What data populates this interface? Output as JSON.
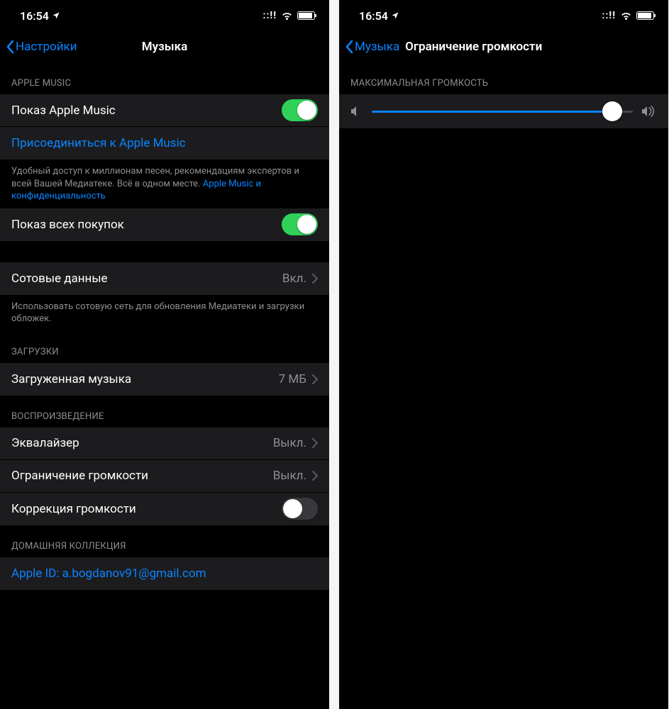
{
  "status": {
    "time": "16:54"
  },
  "left": {
    "back": "Настройки",
    "title": "Музыка",
    "apple_music_header": "APPLE MUSIC",
    "show_apple_music": "Показ Apple Music",
    "join_apple_music": "Присоединиться к Apple Music",
    "apple_music_footer1": "Удобный доступ к миллионам песен, рекомендациям экспертов и всей Вашей Медиатеке. Всё в одном месте.",
    "apple_music_privacy_link": "Apple Music и конфиденциальность",
    "show_all_purchases": "Показ всех покупок",
    "cellular_data": "Сотовые данные",
    "cellular_value": "Вкл.",
    "cellular_footer": "Использовать сотовую сеть для обновления Медиатеки и загрузки обложек.",
    "downloads_header": "ЗАГРУЗКИ",
    "downloaded_music": "Загруженная музыка",
    "downloaded_value": "7 МБ",
    "playback_header": "ВОСПРОИЗВЕДЕНИЕ",
    "equalizer": "Эквалайзер",
    "equalizer_value": "Выкл.",
    "volume_limit": "Ограничение громкости",
    "volume_limit_value": "Выкл.",
    "sound_check": "Коррекция громкости",
    "home_sharing_header": "ДОМАШНЯЯ КОЛЛЕКЦИЯ",
    "apple_id_label": "Apple ID: a.bogdanov91@gmail.com",
    "toggles": {
      "show_apple_music": true,
      "show_all_purchases": true,
      "sound_check": false
    }
  },
  "right": {
    "back": "Музыка",
    "title": "Ограничение громкости",
    "max_volume_header": "МАКСИМАЛЬНАЯ ГРОМКОСТЬ",
    "slider_value": 92
  }
}
